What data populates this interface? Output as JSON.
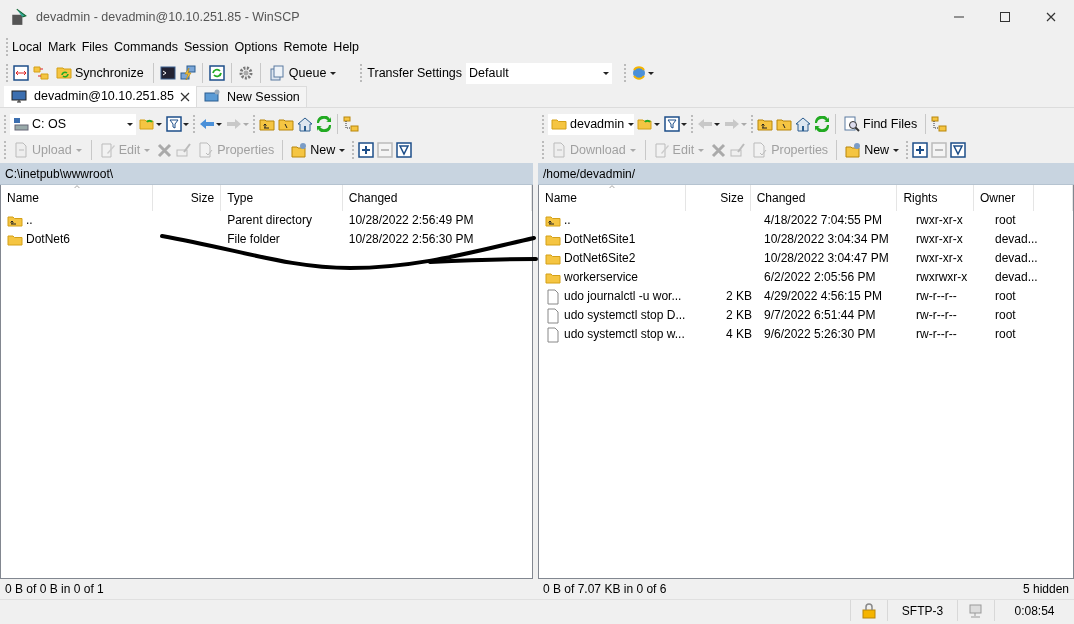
{
  "window": {
    "title": "devadmin - devadmin@10.10.251.85 - WinSCP"
  },
  "menu": [
    "Local",
    "Mark",
    "Files",
    "Commands",
    "Session",
    "Options",
    "Remote",
    "Help"
  ],
  "toolbar": {
    "synchronize": "Synchronize",
    "queue": "Queue",
    "transfer_settings_label": "Transfer Settings",
    "transfer_settings_value": "Default"
  },
  "session_tabs": [
    {
      "label": "devadmin@10.10.251.85",
      "selected": true,
      "kind": "session"
    },
    {
      "label": "New Session",
      "selected": false,
      "kind": "new"
    }
  ],
  "panels": [
    {
      "location": {
        "label": "C: OS",
        "kind": "drive"
      },
      "actions": [
        {
          "label": "Upload",
          "disabled": true
        },
        {
          "label": "Edit",
          "disabled": true
        },
        {
          "label": "Properties",
          "disabled": true
        },
        {
          "label": "New",
          "disabled": false
        }
      ],
      "path": "C:\\inetpub\\wwwroot\\",
      "columns": [
        {
          "label": "Name",
          "sorted": true
        },
        {
          "label": "Size",
          "sorted": false
        },
        {
          "label": "Type",
          "sorted": false
        },
        {
          "label": "Changed",
          "sorted": false
        }
      ],
      "rows": [
        {
          "kind": "parent",
          "cells": [
            "..",
            "",
            "Parent directory",
            "10/28/2022  2:56:49 PM"
          ]
        },
        {
          "kind": "folder",
          "cells": [
            "DotNet6",
            "",
            "File folder",
            "10/28/2022  2:56:30 PM"
          ]
        }
      ],
      "status": "0 B of 0 B in 0 of 1"
    },
    {
      "location": {
        "label": "devadmin",
        "kind": "folder"
      },
      "find_files": "Find Files",
      "actions": [
        {
          "label": "Download",
          "disabled": true
        },
        {
          "label": "Edit",
          "disabled": true
        },
        {
          "label": "Properties",
          "disabled": true
        },
        {
          "label": "New",
          "disabled": false
        }
      ],
      "path": "/home/devadmin/",
      "columns": [
        {
          "label": "Name",
          "sorted": true
        },
        {
          "label": "Size",
          "sorted": false
        },
        {
          "label": "Changed",
          "sorted": false
        },
        {
          "label": "Rights",
          "sorted": false
        },
        {
          "label": "Owner",
          "sorted": false
        }
      ],
      "rows": [
        {
          "kind": "parent",
          "cells": [
            "..",
            "",
            "4/18/2022 7:04:55 PM",
            "rwxr-xr-x",
            "root"
          ]
        },
        {
          "kind": "folder",
          "cells": [
            "DotNet6Site1",
            "",
            "10/28/2022 3:04:34 PM",
            "rwxr-xr-x",
            "devad..."
          ]
        },
        {
          "kind": "folder",
          "cells": [
            "DotNet6Site2",
            "",
            "10/28/2022 3:04:47 PM",
            "rwxr-xr-x",
            "devad..."
          ]
        },
        {
          "kind": "folder",
          "cells": [
            "workerservice",
            "",
            "6/2/2022 2:05:56 PM",
            "rwxrwxr-x",
            "devad..."
          ]
        },
        {
          "kind": "file",
          "cells": [
            "udo journalctl -u wor...",
            "2 KB",
            "4/29/2022 4:56:15 PM",
            "rw-r--r--",
            "root"
          ]
        },
        {
          "kind": "file",
          "cells": [
            "udo systemctl stop D...",
            "2 KB",
            "9/7/2022 6:51:44 PM",
            "rw-r--r--",
            "root"
          ]
        },
        {
          "kind": "file",
          "cells": [
            "udo systemctl stop w...",
            "4 KB",
            "9/6/2022 5:26:30 PM",
            "rw-r--r--",
            "root"
          ]
        }
      ],
      "status": "0 B of 7.07 KB in 0 of 6",
      "status_extra": "5 hidden"
    }
  ],
  "status_bar": {
    "protocol": "SFTP-3",
    "elapsed": "0:08:54"
  }
}
